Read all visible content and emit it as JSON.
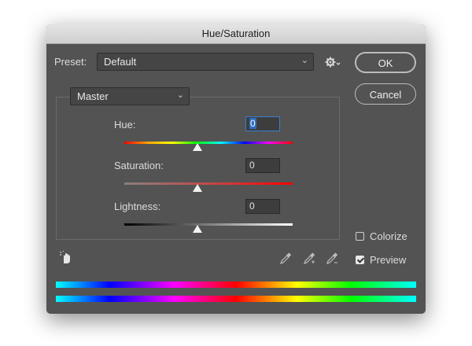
{
  "window": {
    "title": "Hue/Saturation"
  },
  "preset": {
    "label": "Preset:",
    "value": "Default",
    "settings_icon": "gear-icon"
  },
  "buttons": {
    "ok": "OK",
    "cancel": "Cancel"
  },
  "channel": {
    "value": "Master"
  },
  "hue": {
    "label": "Hue:",
    "value": "0",
    "slider_level": 0.5
  },
  "saturation": {
    "label": "Saturation:",
    "value": "0",
    "slider_level": 0.5
  },
  "lightness": {
    "label": "Lightness:",
    "value": "0",
    "slider_level": 0.5
  },
  "options": {
    "colorize_label": "Colorize",
    "colorize_checked": false,
    "preview_label": "Preview",
    "preview_checked": true
  },
  "tools": {
    "on_image_adjust": "hand-adjust-icon",
    "eyedropper": "eyedropper-icon",
    "eyedropper_add": "eyedropper-plus-icon",
    "eyedropper_subtract": "eyedropper-minus-icon"
  },
  "colors": {
    "dialog_bg": "#535353",
    "accent": "#3a7fd0"
  }
}
